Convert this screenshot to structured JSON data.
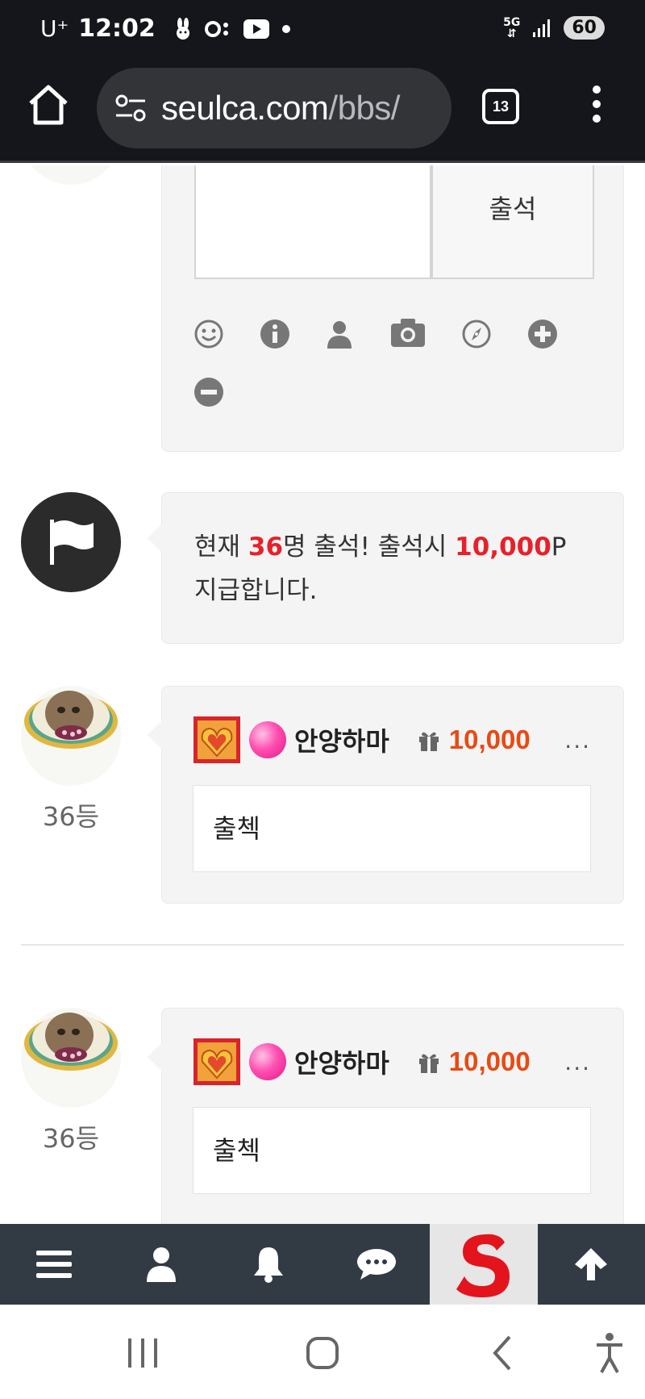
{
  "status_bar": {
    "carrier": "U⁺",
    "time": "12:02",
    "network": "5G",
    "battery": "60",
    "icons": [
      "rabbit-icon",
      "zero-icon",
      "youtube-icon",
      "dot-icon"
    ]
  },
  "browser": {
    "url_host": "seulca.com",
    "url_path": "/bbs/",
    "tab_count": "13"
  },
  "composer": {
    "submit_label": "출석",
    "tools": [
      "smile-icon",
      "info-icon",
      "user-icon",
      "camera-icon",
      "compass-icon",
      "plus-circle-icon",
      "minus-circle-icon"
    ]
  },
  "notice": {
    "prefix": "현재 ",
    "count": "36",
    "mid": "명 출석! 출석시 ",
    "points": "10,000",
    "suffix": "P",
    "line2": "지급합니다."
  },
  "comments": [
    {
      "rank": "36등",
      "nickname": "안양하마",
      "points": "10,000",
      "more": "...",
      "text": "출첵"
    },
    {
      "rank": "36등",
      "nickname": "안양하마",
      "points": "10,000",
      "more": "...",
      "text": "출첵"
    }
  ],
  "site_nav": {
    "items": [
      "menu-icon",
      "user-icon",
      "bell-icon",
      "chat-icon",
      "site-logo",
      "arrow-up-icon"
    ],
    "logo_letter": "S"
  },
  "colors": {
    "accent_red": "#e8202a",
    "points_orange": "#e84a14",
    "nav_bg": "#323a44",
    "browser_bg": "#15161b"
  }
}
